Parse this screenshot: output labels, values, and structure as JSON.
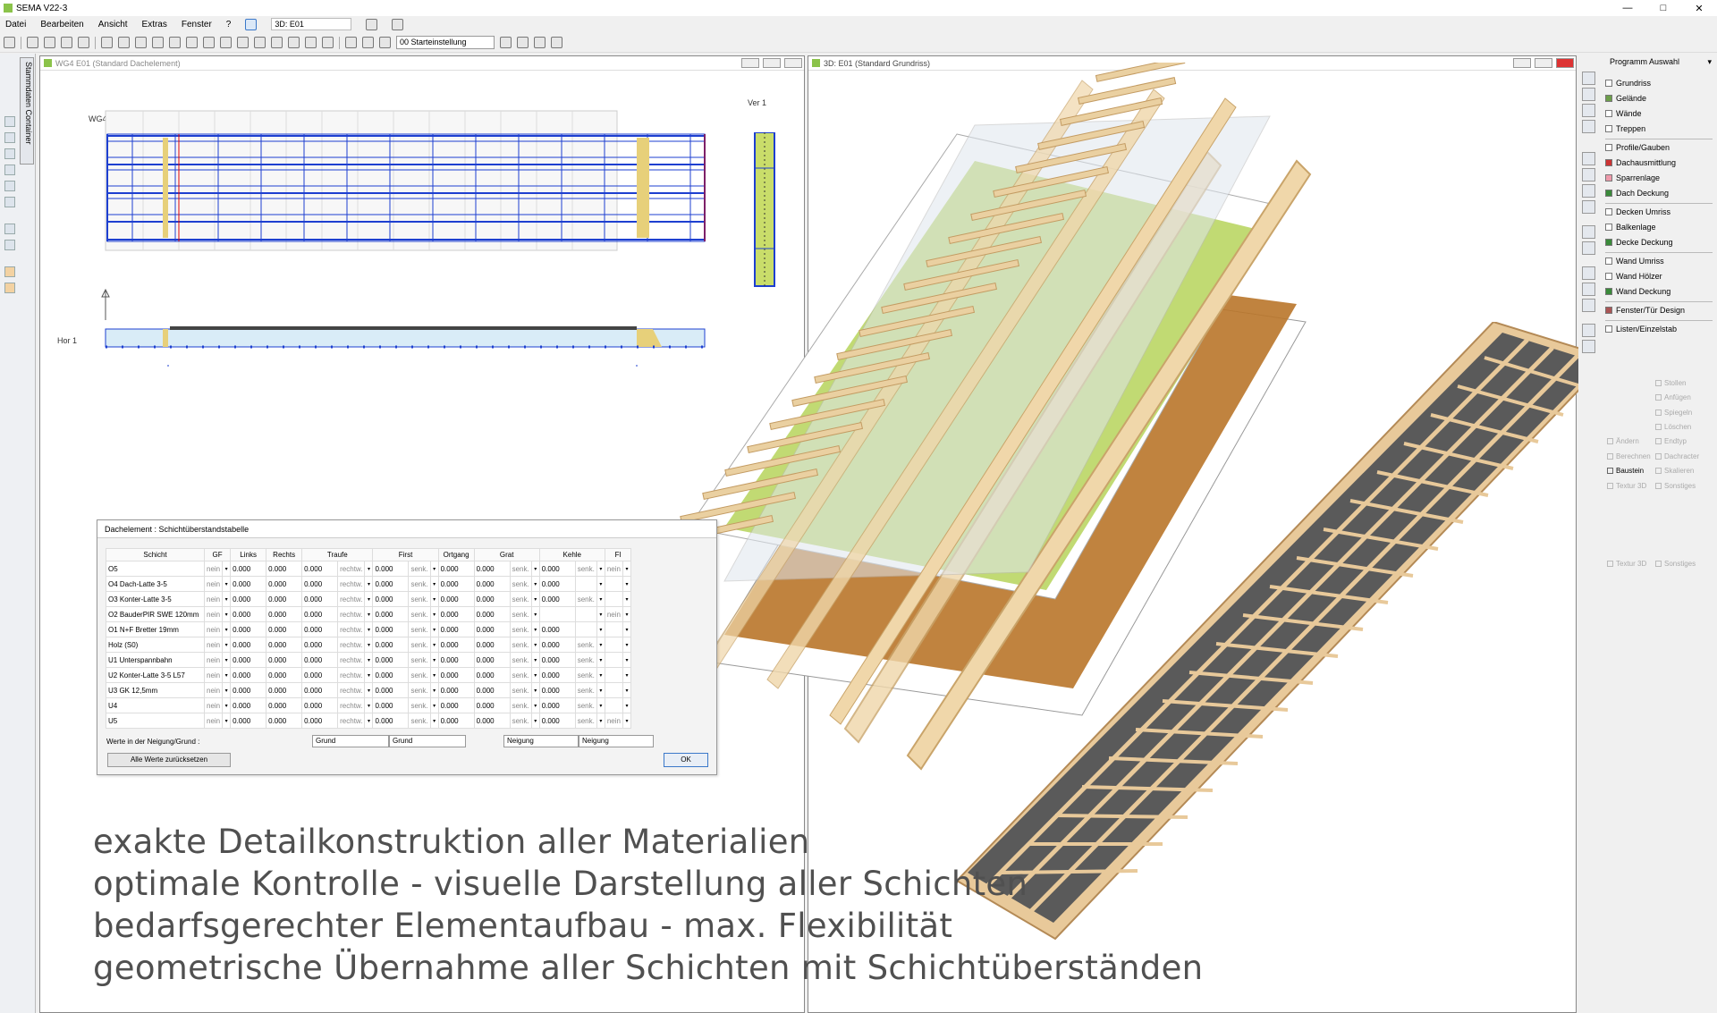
{
  "app": {
    "title": "SEMA V22-3",
    "window_controls": [
      "—",
      "□",
      "✕"
    ]
  },
  "menu": {
    "items": [
      "Datei",
      "Bearbeiten",
      "Ansicht",
      "Extras",
      "Fenster",
      "?"
    ],
    "view_select": "3D: E01"
  },
  "toolbar": {
    "preset_select": "00 Starteinstellung"
  },
  "left_panel": {
    "tab_label": "Stammdaten Container"
  },
  "window_2d": {
    "title": "WG4 E01 (Standard Dachelement)",
    "element_label": "WG4E01",
    "ver_label": "Ver 1",
    "hor_label": "Hor 1"
  },
  "window_3d": {
    "title": "3D: E01 (Standard Grundriss)"
  },
  "right_panel": {
    "header": "Programm Auswahl",
    "groups": [
      [
        "Grundriss",
        "Gelände",
        "Wände",
        "Treppen"
      ],
      [
        "Profile/Gauben",
        "Dachausmittlung",
        "Sparrenlage",
        "Dach Deckung"
      ],
      [
        "Decken Umriss",
        "Balkenlage",
        "Decke Deckung"
      ],
      [
        "Wand Umriss",
        "Wand Hölzer",
        "Wand Deckung"
      ],
      [
        "Fenster/Tür Design"
      ],
      [
        "Listen/Einzelstab"
      ]
    ],
    "tools": [
      [
        "",
        "Stollen"
      ],
      [
        "",
        "Anfügen"
      ],
      [
        "",
        "Spiegeln"
      ],
      [
        "",
        "Löschen"
      ],
      [
        "Ändern",
        "Endtyp"
      ],
      [
        "Berechnen",
        "Dachracter"
      ],
      [
        "Baustein",
        "Skalieren"
      ],
      [
        "Textur 3D",
        "Sonstiges"
      ]
    ],
    "bottom_tools": [
      "Textur 3D",
      "Sonstiges"
    ]
  },
  "dialog": {
    "title": "Dachelement : Schichtüberstandstabelle",
    "headers": [
      "Schicht",
      "GF",
      "Links",
      "Rechts",
      "Traufe",
      "First",
      "Ortgang",
      "Grat",
      "Kehle",
      "Fl"
    ],
    "rows": [
      {
        "name": "O5",
        "gf": "nein",
        "links": "0.000",
        "rechts": "0.000",
        "traufe": "0.000",
        "traufe_mode": "rechtw.",
        "first": "0.000",
        "first_mode": "senk.",
        "ortgang": "0.000",
        "grat": "0.000",
        "grat_mode": "senk.",
        "kehle": "0.000",
        "kehle_mode": "senk.",
        "fl": "nein"
      },
      {
        "name": "O4 Dach-Latte 3-5",
        "gf": "nein",
        "links": "0.000",
        "rechts": "0.000",
        "traufe": "0.000",
        "traufe_mode": "rechtw.",
        "first": "0.000",
        "first_mode": "senk.",
        "ortgang": "0.000",
        "grat": "0.000",
        "grat_mode": "senk.",
        "kehle": "0.000",
        "kehle_mode": "",
        "fl": ""
      },
      {
        "name": "O3 Konter-Latte 3-5",
        "gf": "nein",
        "links": "0.000",
        "rechts": "0.000",
        "traufe": "0.000",
        "traufe_mode": "rechtw.",
        "first": "0.000",
        "first_mode": "senk.",
        "ortgang": "0.000",
        "grat": "0.000",
        "grat_mode": "senk.",
        "kehle": "0.000",
        "kehle_mode": "senk.",
        "fl": ""
      },
      {
        "name": "O2 BauderPIR SWE 120mm",
        "gf": "nein",
        "links": "0.000",
        "rechts": "0.000",
        "traufe": "0.000",
        "traufe_mode": "rechtw.",
        "first": "0.000",
        "first_mode": "senk.",
        "ortgang": "0.000",
        "grat": "0.000",
        "grat_mode": "senk.",
        "kehle": "",
        "kehle_mode": "",
        "fl": "nein"
      },
      {
        "name": "O1 N+F Bretter 19mm",
        "gf": "nein",
        "links": "0.000",
        "rechts": "0.000",
        "traufe": "0.000",
        "traufe_mode": "rechtw.",
        "first": "0.000",
        "first_mode": "senk.",
        "ortgang": "0.000",
        "grat": "0.000",
        "grat_mode": "senk.",
        "kehle": "0.000",
        "kehle_mode": "",
        "fl": ""
      },
      {
        "name": "Holz (S0)",
        "gf": "nein",
        "links": "0.000",
        "rechts": "0.000",
        "traufe": "0.000",
        "traufe_mode": "rechtw.",
        "first": "0.000",
        "first_mode": "senk.",
        "ortgang": "0.000",
        "grat": "0.000",
        "grat_mode": "senk.",
        "kehle": "0.000",
        "kehle_mode": "senk.",
        "fl": ""
      },
      {
        "name": "U1 Unterspannbahn",
        "gf": "nein",
        "links": "0.000",
        "rechts": "0.000",
        "traufe": "0.000",
        "traufe_mode": "rechtw.",
        "first": "0.000",
        "first_mode": "senk.",
        "ortgang": "0.000",
        "grat": "0.000",
        "grat_mode": "senk.",
        "kehle": "0.000",
        "kehle_mode": "senk.",
        "fl": ""
      },
      {
        "name": "U2 Konter-Latte 3-5 L57",
        "gf": "nein",
        "links": "0.000",
        "rechts": "0.000",
        "traufe": "0.000",
        "traufe_mode": "rechtw.",
        "first": "0.000",
        "first_mode": "senk.",
        "ortgang": "0.000",
        "grat": "0.000",
        "grat_mode": "senk.",
        "kehle": "0.000",
        "kehle_mode": "senk.",
        "fl": ""
      },
      {
        "name": "U3 GK 12,5mm",
        "gf": "nein",
        "links": "0.000",
        "rechts": "0.000",
        "traufe": "0.000",
        "traufe_mode": "rechtw.",
        "first": "0.000",
        "first_mode": "senk.",
        "ortgang": "0.000",
        "grat": "0.000",
        "grat_mode": "senk.",
        "kehle": "0.000",
        "kehle_mode": "senk.",
        "fl": ""
      },
      {
        "name": "U4",
        "gf": "nein",
        "links": "0.000",
        "rechts": "0.000",
        "traufe": "0.000",
        "traufe_mode": "rechtw.",
        "first": "0.000",
        "first_mode": "senk.",
        "ortgang": "0.000",
        "grat": "0.000",
        "grat_mode": "senk.",
        "kehle": "0.000",
        "kehle_mode": "senk.",
        "fl": ""
      },
      {
        "name": "U5",
        "gf": "nein",
        "links": "0.000",
        "rechts": "0.000",
        "traufe": "0.000",
        "traufe_mode": "rechtw.",
        "first": "0.000",
        "first_mode": "senk.",
        "ortgang": "0.000",
        "grat": "0.000",
        "grat_mode": "senk.",
        "kehle": "0.000",
        "kehle_mode": "senk.",
        "fl": "nein"
      }
    ],
    "footer_label": "Werte in der Neigung/Grund :",
    "footer_selects": [
      "Grund",
      "Grund",
      "Neigung",
      "Neigung"
    ],
    "reset_button": "Alle Werte zurücksetzen",
    "ok_button": "OK"
  },
  "overlay_text": [
    "exakte Detailkonstruktion aller Materialien",
    "optimale Kontrolle - visuelle Darstellung aller Schichten",
    "bedarfsgerechter Elementaufbau - max. Flexibilität",
    "geometrische Übernahme aller Schichten mit Schichtüberständen"
  ],
  "colors": {
    "accent_green": "#8bc34a",
    "wood": "#e8c99a",
    "insulation": "#b6d35a",
    "osb": "#b9762a",
    "panel_dark": "#5a5a5a",
    "plan_blue": "#1d3fd0"
  }
}
